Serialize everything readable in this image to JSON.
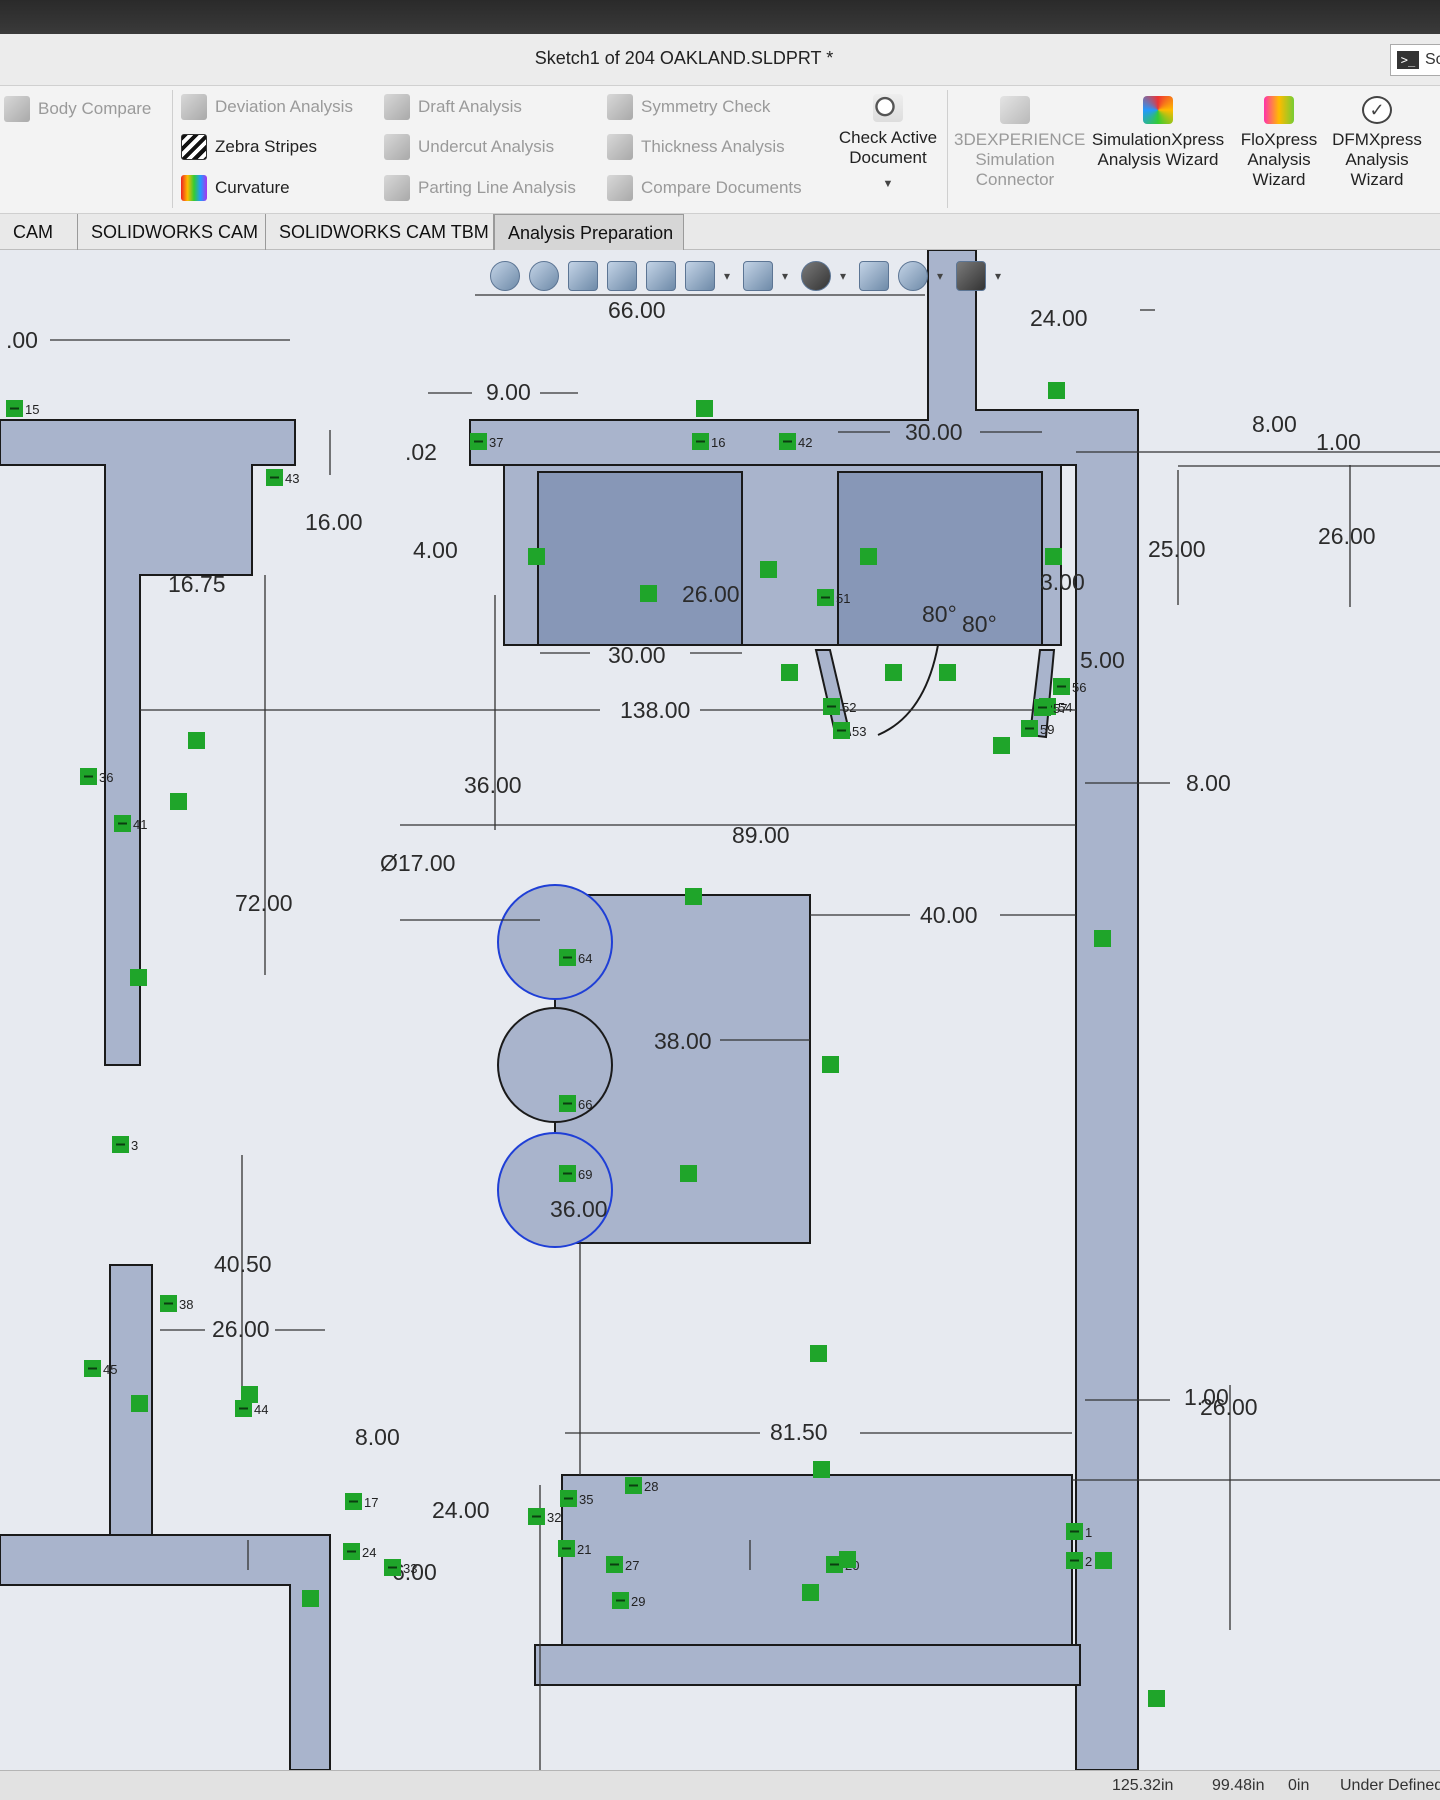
{
  "window": {
    "title": "Sketch1 of 204 OAKLAND.SLDPRT *",
    "search_label": "Sc"
  },
  "ribbon": {
    "body_compare": "Body Compare",
    "deviation_analysis": "Deviation Analysis",
    "zebra_stripes": "Zebra Stripes",
    "curvature": "Curvature",
    "draft_analysis": "Draft Analysis",
    "undercut_analysis": "Undercut Analysis",
    "parting_line_analysis": "Parting Line Analysis",
    "symmetry_check": "Symmetry Check",
    "thickness_analysis": "Thickness Analysis",
    "compare_documents": "Compare Documents",
    "check_active_document": [
      "Check Active",
      "Document"
    ],
    "experience_connector": [
      "3DEXPERIENCE",
      "Simulation",
      "Connector"
    ],
    "simulationxpress": [
      "SimulationXpress",
      "Analysis Wizard"
    ],
    "floxpress": [
      "FloXpress",
      "Analysis",
      "Wizard"
    ],
    "dfmxpress": [
      "DFMXpress",
      "Analysis",
      "Wizard"
    ]
  },
  "tabs": [
    "CAM",
    "SOLIDWORKS CAM",
    "SOLIDWORKS CAM TBM",
    "Analysis Preparation"
  ],
  "active_tab": "Analysis Preparation",
  "dimensions": {
    "d_00": ".00",
    "d_66": "66.00",
    "d_24": "24.00",
    "d_9": "9.00",
    "d_02": ".02",
    "d_30_top": "30.00",
    "d_8_top": "8.00",
    "d_1_top": "1.00",
    "d_16": "16.00",
    "d_4": "4.00",
    "d_25": "25.00",
    "d_26_right": "26.00",
    "d_1675": "16.75",
    "d_26_mid": "26.00",
    "d_3": "3.00",
    "d_80a": "80°",
    "d_80b": "80°",
    "d_30_mid": "30.00",
    "d_5": "5.00",
    "d_138": "138.00",
    "d_36_top": "36.00",
    "d_8_right": "8.00",
    "d_89": "89.00",
    "d_dia17": "Ø17.00",
    "d_72": "72.00",
    "d_40": "40.00",
    "d_38": "38.00",
    "d_36_bot": "36.00",
    "d_4050": "40.50",
    "d_26_low": "26.00",
    "d_1_low": "1.00",
    "d_26_low_r": "26.00",
    "d_8150": "81.50",
    "d_8_low": "8.00",
    "d_24_low": "24.00",
    "d_6": "6.00"
  },
  "relations": [
    "15",
    "16",
    "42",
    "43",
    "37",
    "36",
    "41",
    "38",
    "45",
    "44",
    "17",
    "24",
    "33",
    "35",
    "32",
    "28",
    "27",
    "20",
    "29",
    "21",
    "1",
    "2",
    "51",
    "52",
    "53",
    "54",
    "56",
    "57",
    "59",
    "64",
    "66",
    "69",
    "3"
  ],
  "statusbar": {
    "x": "125.32in",
    "y": "99.48in",
    "z": "0in",
    "state": "Under Defined"
  },
  "colors": {
    "wall_fill": "#a9b4cc",
    "block_fill": "#8797b7",
    "sketch_line": "#1a1a1a",
    "selected": "#1f3fd6",
    "relation_green": "#1fa52a",
    "canvas_bg": "#e7eaf0"
  },
  "icons": {
    "check_active_document": "check-document-icon",
    "simulationxpress": "simulation-wizard-icon",
    "floxpress": "flow-wizard-icon",
    "dfmxpress": "dfm-check-icon"
  }
}
